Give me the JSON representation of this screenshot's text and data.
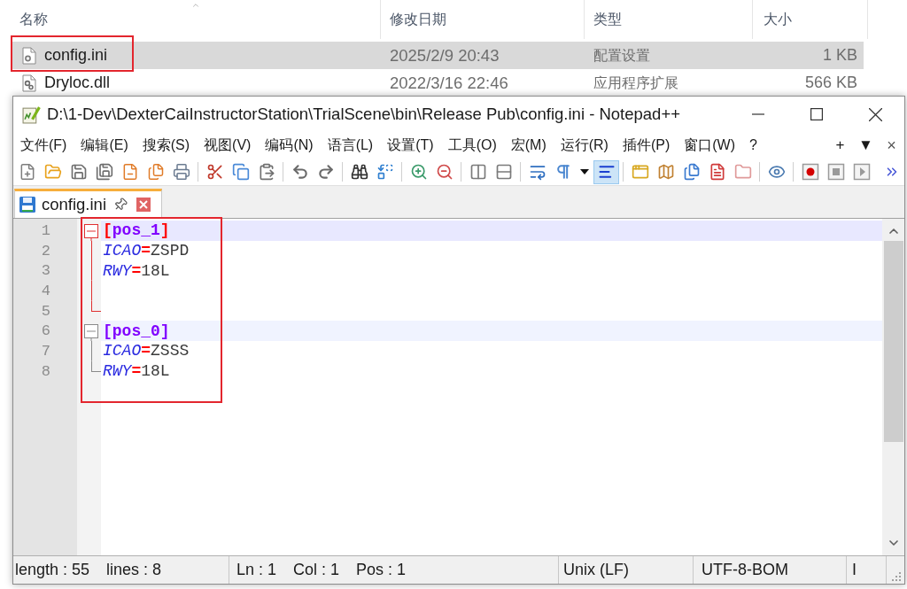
{
  "explorer": {
    "columns": [
      {
        "label": "名称",
        "sorted": true
      },
      {
        "label": "修改日期",
        "sorted": false
      },
      {
        "label": "类型",
        "sorted": false
      },
      {
        "label": "大小",
        "sorted": false
      }
    ],
    "rows": [
      {
        "kind": "config",
        "name": "config.ini",
        "modified": "2025/2/9 20:43",
        "type": "配置设置",
        "size": "1 KB",
        "selected": true,
        "annotated": true
      },
      {
        "kind": "dll",
        "name": "Dryloc.dll",
        "modified": "2022/3/16 22:46",
        "type": "应用程序扩展",
        "size": "566 KB",
        "selected": false,
        "annotated": false
      }
    ]
  },
  "notepad": {
    "title": "D:\\1-Dev\\DexterCaiInstructorStation\\TrialScene\\bin\\Release Pub\\config.ini - Notepad++",
    "menu": [
      "文件(F)",
      "编辑(E)",
      "搜索(S)",
      "视图(V)",
      "编码(N)",
      "语言(L)",
      "设置(T)",
      "工具(O)",
      "宏(M)",
      "运行(R)",
      "插件(P)",
      "窗口(W)",
      "?"
    ],
    "menu_right": [
      "+",
      "▼",
      "×"
    ],
    "toolbar": [
      [
        {
          "kind": "new",
          "selected": false
        },
        {
          "kind": "open",
          "selected": false
        },
        {
          "kind": "save",
          "selected": false
        },
        {
          "kind": "save_all",
          "selected": false
        },
        {
          "kind": "close",
          "selected": false
        },
        {
          "kind": "close_all",
          "selected": false
        },
        {
          "kind": "print",
          "selected": false
        }
      ],
      [
        {
          "kind": "cut",
          "selected": false
        },
        {
          "kind": "copy",
          "selected": false
        },
        {
          "kind": "paste",
          "selected": false
        }
      ],
      [
        {
          "kind": "undo",
          "selected": false
        },
        {
          "kind": "redo",
          "selected": false
        }
      ],
      [
        {
          "kind": "find",
          "selected": false
        },
        {
          "kind": "replace",
          "selected": false
        }
      ],
      [
        {
          "kind": "zoom_in",
          "selected": false
        },
        {
          "kind": "zoom_out",
          "selected": false
        }
      ],
      [
        {
          "kind": "sync_vertical",
          "selected": false
        },
        {
          "kind": "sync_horizontal",
          "selected": false
        }
      ],
      [
        {
          "kind": "wrap",
          "selected": false
        },
        {
          "kind": "all_chars",
          "selected": false
        },
        {
          "kind": "dropdown",
          "selected": false
        },
        {
          "kind": "indent_guide",
          "selected": true
        }
      ],
      [
        {
          "kind": "user_language",
          "selected": false
        },
        {
          "kind": "document_map",
          "selected": false
        },
        {
          "kind": "document_list",
          "selected": false
        },
        {
          "kind": "function_list",
          "selected": false
        },
        {
          "kind": "folder_workspace",
          "selected": false
        }
      ],
      [
        {
          "kind": "monitoring",
          "selected": false
        }
      ],
      [
        {
          "kind": "record",
          "selected": false
        },
        {
          "kind": "stop",
          "selected": false
        },
        {
          "kind": "play",
          "selected": false
        }
      ]
    ],
    "tabs": [
      {
        "label": "config.ini",
        "selected": true
      }
    ],
    "editor": {
      "annotated": true,
      "lines": [
        {
          "number": "1",
          "kind": "fold_start",
          "fold_active": true,
          "current": true,
          "shaded": false,
          "tokens": [
            {
              "text": "[",
              "kind": "brace"
            },
            {
              "text": "pos_1",
              "kind": "section"
            },
            {
              "text": "]",
              "kind": "brace"
            }
          ]
        },
        {
          "number": "2",
          "kind": "fold_body",
          "fold_active": true,
          "current": false,
          "shaded": false,
          "tokens": [
            {
              "text": "ICAO",
              "kind": "key"
            },
            {
              "text": "=",
              "kind": "operator"
            },
            {
              "text": "ZSPD",
              "kind": "value"
            }
          ]
        },
        {
          "number": "3",
          "kind": "fold_body",
          "fold_active": true,
          "current": false,
          "shaded": false,
          "tokens": [
            {
              "text": "RWY",
              "kind": "key"
            },
            {
              "text": "=",
              "kind": "operator"
            },
            {
              "text": "18L",
              "kind": "value"
            }
          ]
        },
        {
          "number": "4",
          "kind": "fold_body",
          "fold_active": true,
          "current": false,
          "shaded": false
        },
        {
          "number": "5",
          "kind": "fold_end",
          "fold_active": true,
          "current": false,
          "shaded": false
        },
        {
          "number": "6",
          "kind": "fold_start",
          "fold_active": false,
          "current": false,
          "shaded": true,
          "tokens": [
            {
              "text": "[pos_0]",
              "kind": "section"
            }
          ]
        },
        {
          "number": "7",
          "kind": "fold_body",
          "fold_active": false,
          "current": false,
          "shaded": false,
          "tokens": [
            {
              "text": "ICAO",
              "kind": "key"
            },
            {
              "text": "=",
              "kind": "operator"
            },
            {
              "text": "ZSSS",
              "kind": "value"
            }
          ]
        },
        {
          "number": "8",
          "kind": "fold_end",
          "fold_active": false,
          "current": false,
          "shaded": false,
          "tokens": [
            {
              "text": "RWY",
              "kind": "key"
            },
            {
              "text": "=",
              "kind": "operator"
            },
            {
              "text": "18L",
              "kind": "value"
            }
          ]
        }
      ]
    },
    "status_bar": {
      "sections": [
        [
          "length : 55",
          "lines : 8"
        ],
        [
          "Ln : 1",
          "Col : 1",
          "Pos : 1"
        ],
        [
          "Unix (LF)"
        ],
        [
          "UTF-8-BOM"
        ],
        [
          "I"
        ]
      ]
    }
  }
}
